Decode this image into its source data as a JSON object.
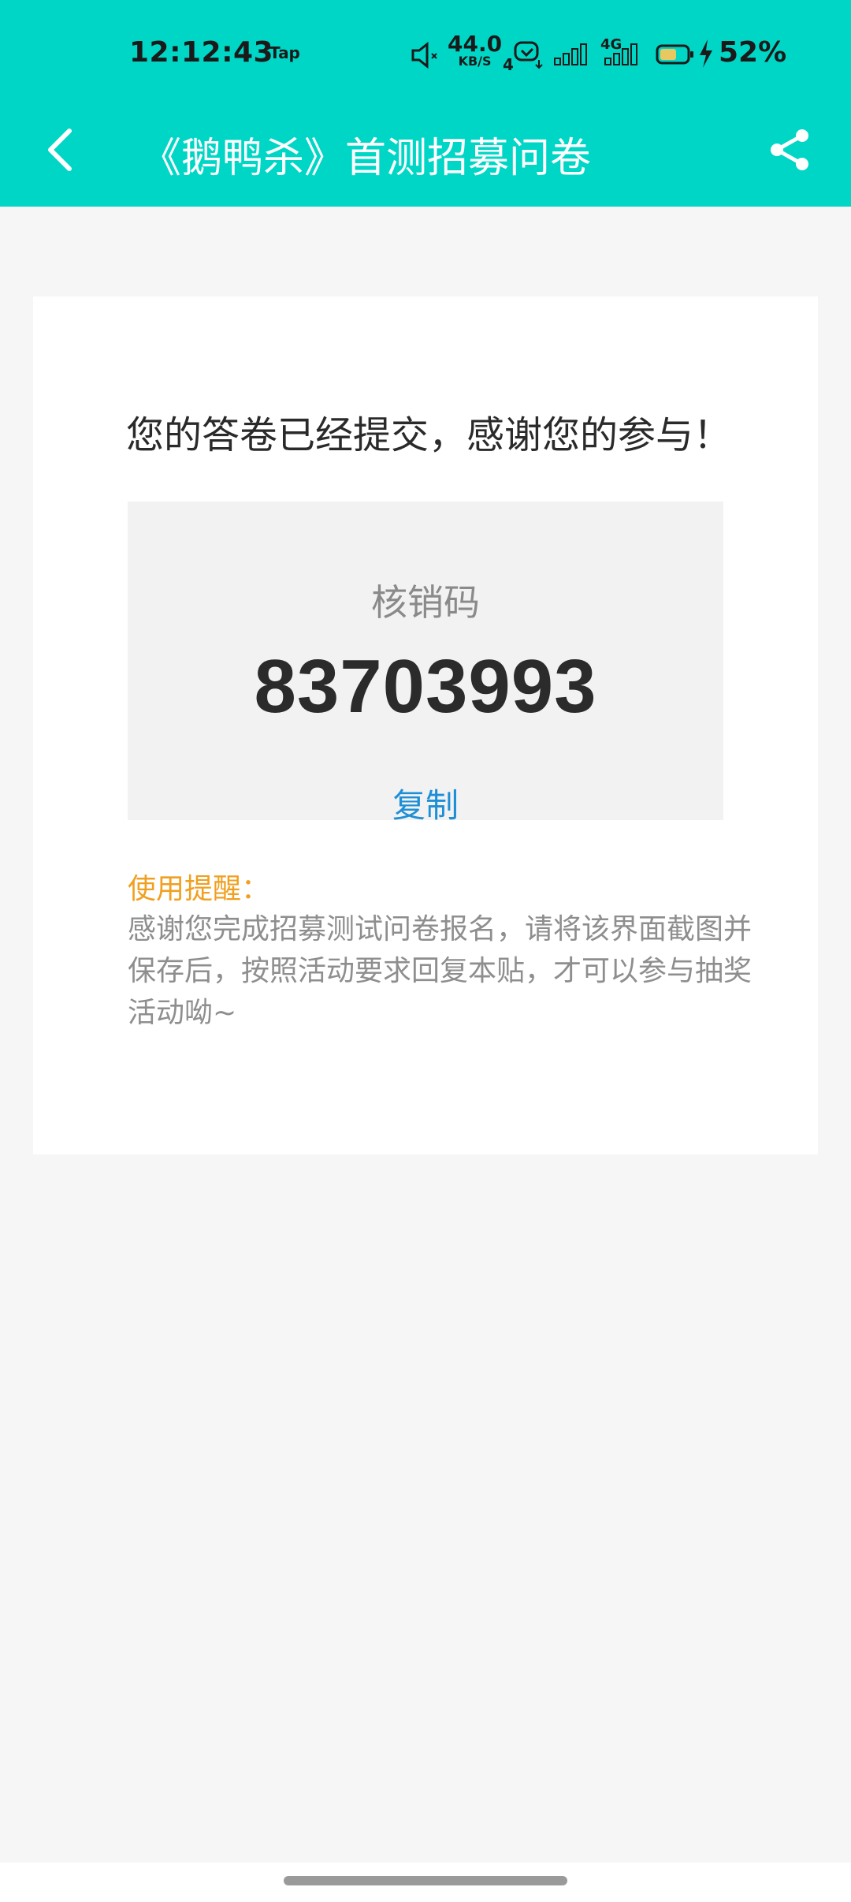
{
  "status_bar": {
    "time": "12:12:43",
    "app_tag": "Tap",
    "net_speed_value": "44.0",
    "net_speed_unit": "KB/S",
    "sim_number": "4",
    "network_type": "4G",
    "battery_percent": "52%"
  },
  "nav": {
    "title": "《鹅鸭杀》首测招募问卷",
    "back_icon": "chevron-left-icon",
    "share_icon": "share-icon"
  },
  "result": {
    "thanks_message": "您的答卷已经提交，感谢您的参与！",
    "code_label": "核销码",
    "code_value": "83703993",
    "copy_label": "复制"
  },
  "tips": {
    "title": "使用提醒：",
    "body": "感谢您完成招募测试问卷报名，请将该界面截图并保存后，按照活动要求回复本贴，才可以参与抽奖活动呦~"
  },
  "colors": {
    "header_bg": "#00d6c6",
    "copy_link": "#1e8fd6",
    "tip_title": "#f0a020"
  }
}
